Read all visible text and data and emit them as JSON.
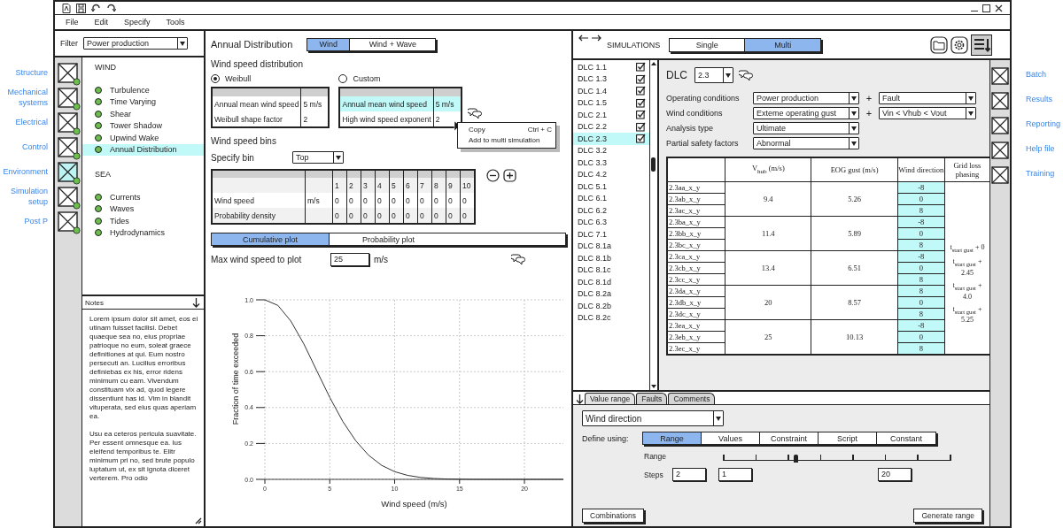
{
  "menu": [
    "File",
    "Edit",
    "Specify",
    "Tools"
  ],
  "nav_left": [
    {
      "label": "Structure",
      "selected": false
    },
    {
      "label": "Mechanical systems",
      "selected": false
    },
    {
      "label": "Electrical",
      "selected": false
    },
    {
      "label": "Control",
      "selected": false
    },
    {
      "label": "Environment",
      "selected": true
    },
    {
      "label": "Simulation setup",
      "selected": false
    },
    {
      "label": "Post P",
      "selected": false
    }
  ],
  "filter": {
    "label": "Filter",
    "value": "Power production"
  },
  "tree": [
    {
      "heading": "WIND",
      "items": [
        {
          "label": "Turbulence",
          "selected": false
        },
        {
          "label": "Time Varying",
          "selected": false
        },
        {
          "label": "Shear",
          "selected": false
        },
        {
          "label": "Tower Shadow",
          "selected": false
        },
        {
          "label": "Upwind Wake",
          "selected": false
        },
        {
          "label": "Annual Distribution",
          "selected": true
        }
      ]
    },
    {
      "heading": "SEA",
      "items": [
        {
          "label": "Currents",
          "selected": false
        },
        {
          "label": "Waves",
          "selected": false
        },
        {
          "label": "Tides",
          "selected": false
        },
        {
          "label": "Hydrodynamics",
          "selected": false
        }
      ]
    }
  ],
  "notes": {
    "title": "Notes",
    "paragraphs": [
      "Lorem ipsum dolor sit amet, eos ei utinam fuisset facilisi. Debet quaeque sea no, eius propriae patrioque no eum, soleat graece definitiones at qui. Eum nostro persecuti an. Lucilius erroribus definiebas ex his, error ridens minimum cu eam. Vivendum constituam vix ad, quod legere dissentiunt has id. Vim in blandit vituperata, sed eius quas aperiam ea.",
      "Usu ea ceteros pericula suavitate. Per essent omnesque ea. Ius eleifend temporibus te. Elitr minimum pri no, sed brute populo luptatum ut, ex sit ignota diceret verterem. Pro odio"
    ]
  },
  "annual": {
    "title": "Annual Distribution",
    "modes": [
      {
        "label": "Wind",
        "selected": true
      },
      {
        "label": "Wind + Wave",
        "selected": false
      }
    ]
  },
  "distribution": {
    "heading": "Wind speed distribution",
    "options": [
      {
        "label": "Weibull",
        "selected": true,
        "rows": [
          {
            "label": "Annual mean wind speed",
            "value": "5 m/s",
            "highlighted": false
          },
          {
            "label": "Weibull shape factor",
            "value": "2",
            "highlighted": false
          }
        ]
      },
      {
        "label": "Custom",
        "selected": false,
        "rows": [
          {
            "label": "Annual mean wind speed",
            "value": "5 m/s",
            "highlighted": true
          },
          {
            "label": "High wind speed exponent",
            "value": "2",
            "highlighted": false
          }
        ]
      }
    ]
  },
  "context_menu": [
    {
      "label": "Copy",
      "shortcut": "Ctrl + C"
    },
    {
      "label": "Add to multi simulation"
    }
  ],
  "bins": {
    "heading": "Wind speed bins",
    "specify_label": "Specify bin",
    "specify_value": "Top",
    "columns": [
      "1",
      "2",
      "3",
      "4",
      "5",
      "6",
      "7",
      "8",
      "9",
      "10"
    ],
    "rows": [
      {
        "label": "Wind speed",
        "unit": "m/s",
        "values": [
          "0",
          "0",
          "0",
          "0",
          "0",
          "0",
          "0",
          "0",
          "0",
          "0"
        ]
      },
      {
        "label": "Probability density",
        "values": [
          "0",
          "0",
          "0",
          "0",
          "0",
          "0",
          "0",
          "0",
          "0",
          "0"
        ]
      }
    ]
  },
  "plot_modes": [
    {
      "label": "Cumulative plot",
      "selected": true
    },
    {
      "label": "Probability plot",
      "selected": false
    }
  ],
  "max_speed": {
    "label": "Max wind speed to plot",
    "value": "25",
    "unit": "m/s"
  },
  "chart_data": {
    "type": "line",
    "xlabel": "Wind speed (m/s)",
    "ylabel": "Fraction of time exceeded",
    "x": [
      0,
      1,
      2,
      3,
      4,
      5,
      6,
      7,
      8,
      9,
      10,
      11,
      12,
      13,
      14,
      15,
      16,
      17,
      18,
      19,
      20,
      21,
      22,
      23
    ],
    "grid": true,
    "series": [
      {
        "color": "#333333",
        "values": [
          1,
          0.969,
          0.882,
          0.754,
          0.605,
          0.456,
          0.323,
          0.215,
          0.134,
          0.078,
          0.043,
          0.022,
          0.011,
          0.005,
          0.002,
          0.001,
          0,
          0,
          0,
          0,
          0,
          0,
          0,
          0
        ]
      }
    ],
    "xlim": [
      0,
      23
    ],
    "ylim": [
      0,
      1
    ],
    "xticks": [
      {
        "value": 0,
        "label": "0"
      },
      {
        "value": 5,
        "label": "5"
      },
      {
        "value": 10,
        "label": "10"
      },
      {
        "value": 15,
        "label": "15"
      },
      {
        "value": 20,
        "label": "20"
      }
    ],
    "yticks": [
      {
        "value": 0,
        "label": "0.0"
      },
      {
        "value": 0.2,
        "label": "0.2"
      },
      {
        "value": 0.4,
        "label": "0.4"
      },
      {
        "value": 0.6,
        "label": "0.6"
      },
      {
        "value": 0.8,
        "label": "0.8"
      },
      {
        "value": 1,
        "label": "1.0"
      }
    ]
  },
  "simulations": {
    "title": "SIMULATIONS",
    "modes": [
      {
        "label": "Single",
        "selected": false
      },
      {
        "label": "Multi",
        "selected": true
      }
    ]
  },
  "dlc_list": [
    {
      "label": "DLC 1.1",
      "checked": true,
      "selected": false
    },
    {
      "label": "DLC 1.3",
      "checked": true,
      "selected": false
    },
    {
      "label": "DLC 1.4",
      "checked": true,
      "selected": false
    },
    {
      "label": "DLC 1.5",
      "checked": true,
      "selected": false
    },
    {
      "label": "DLC 2.1",
      "checked": true,
      "selected": false
    },
    {
      "label": "DLC 2.2",
      "checked": true,
      "selected": false
    },
    {
      "label": "DLC 2.3",
      "checked": true,
      "selected": true
    },
    {
      "label": "DLC 3.2",
      "checked": false,
      "selected": false
    },
    {
      "label": "DLC 3.3",
      "checked": false,
      "selected": false
    },
    {
      "label": "DLC 4.2",
      "checked": false,
      "selected": false
    },
    {
      "label": "DLC 5.1",
      "checked": false,
      "selected": false
    },
    {
      "label": "DLC 6.1",
      "checked": false,
      "selected": false
    },
    {
      "label": "DLC 6.2",
      "checked": false,
      "selected": false
    },
    {
      "label": "DLC 6.3",
      "checked": false,
      "selected": false
    },
    {
      "label": "DLC 7.1",
      "checked": false,
      "selected": false
    },
    {
      "label": "DLC 8.1a",
      "checked": false,
      "selected": false
    },
    {
      "label": "DLC 8.1b",
      "checked": false,
      "selected": false
    },
    {
      "label": "DLC 8.1c",
      "checked": false,
      "selected": false
    },
    {
      "label": "DLC 8.1d",
      "checked": false,
      "selected": false
    },
    {
      "label": "DLC 8.2a",
      "checked": false,
      "selected": false
    },
    {
      "label": "DLC 8.2b",
      "checked": false,
      "selected": false
    },
    {
      "label": "DLC 8.2c",
      "checked": false,
      "selected": false
    }
  ],
  "dlc": {
    "label": "DLC",
    "value": "2.3"
  },
  "conditions": [
    {
      "label": "Operating conditions",
      "values": [
        "Power production",
        "Fault"
      ],
      "joiner": "+"
    },
    {
      "label": "Wind conditions",
      "values": [
        "Exteme operating gust",
        "Vin < Vhub < Vout"
      ],
      "joiner": "+"
    },
    {
      "label": "Analysis type",
      "values": [
        "Ultimate"
      ]
    },
    {
      "label": "Partial safety factors",
      "values": [
        "Abnormal"
      ]
    }
  ],
  "case_table": {
    "columns": [
      "V$_{hub}$ (m/s)",
      "EOG gust (m/s)",
      "Wind direction",
      "Grid loss phasing"
    ],
    "groups": [
      {
        "vhub": "9.4",
        "eog": "5.26",
        "cases": [
          {
            "name": "2.3aa_x_y",
            "direction": "-8"
          },
          {
            "name": "2.3ab_x_y",
            "direction": "0"
          },
          {
            "name": "2.3ac_x_y",
            "direction": "8"
          }
        ]
      },
      {
        "vhub": "11.4",
        "eog": "5.89",
        "cases": [
          {
            "name": "2.3ba_x_y",
            "direction": "-8"
          },
          {
            "name": "2.3bb_x_y",
            "direction": "0"
          },
          {
            "name": "2.3bc_x_y",
            "direction": "8"
          }
        ]
      },
      {
        "vhub": "13.4",
        "eog": "6.51",
        "cases": [
          {
            "name": "2.3ca_x_y",
            "direction": "-8"
          },
          {
            "name": "2.3cb_x_y",
            "direction": "0"
          },
          {
            "name": "2.3cc_x_y",
            "direction": "8"
          }
        ]
      },
      {
        "vhub": "20",
        "eog": "8.57",
        "cases": [
          {
            "name": "2.3da_x_y",
            "direction": "8"
          },
          {
            "name": "2.3db_x_y",
            "direction": "0"
          },
          {
            "name": "2.3dc_x_y",
            "direction": "8"
          }
        ]
      },
      {
        "vhub": "25",
        "eog": "10.13",
        "cases": [
          {
            "name": "2.3ea_x_y",
            "direction": "-8"
          },
          {
            "name": "2.3eb_x_y",
            "direction": "0"
          },
          {
            "name": "2.3ec_x_y",
            "direction": "8"
          }
        ]
      }
    ],
    "phasing": [
      "t$_{start gust}$ + 0",
      "t$_{start gust}$ + 2.45",
      "t$_{start gust}$ + 4.0",
      "t$_{start gust}$ + 5.25"
    ]
  },
  "bottom_tabs": [
    {
      "label": "Value range",
      "selected": true
    },
    {
      "label": "Faults",
      "selected": false
    },
    {
      "label": "Comments",
      "selected": false
    }
  ],
  "value_range": {
    "parameter": "Wind direction",
    "define_label": "Define using:",
    "define_modes": [
      {
        "label": "Range",
        "selected": true
      },
      {
        "label": "Values",
        "selected": false
      },
      {
        "label": "Constraint",
        "selected": false
      },
      {
        "label": "Script",
        "selected": false
      },
      {
        "label": "Constant",
        "selected": false
      }
    ],
    "range": {
      "label": "Range",
      "level": 0.32
    },
    "steps": {
      "label": "Steps",
      "value": "2"
    },
    "range_min": "1",
    "range_max": "20"
  },
  "buttons": [
    "Combinations",
    "Generate range"
  ],
  "nav_right": [
    "Batch",
    "Results",
    "Reporting",
    "Help file",
    "Training"
  ]
}
